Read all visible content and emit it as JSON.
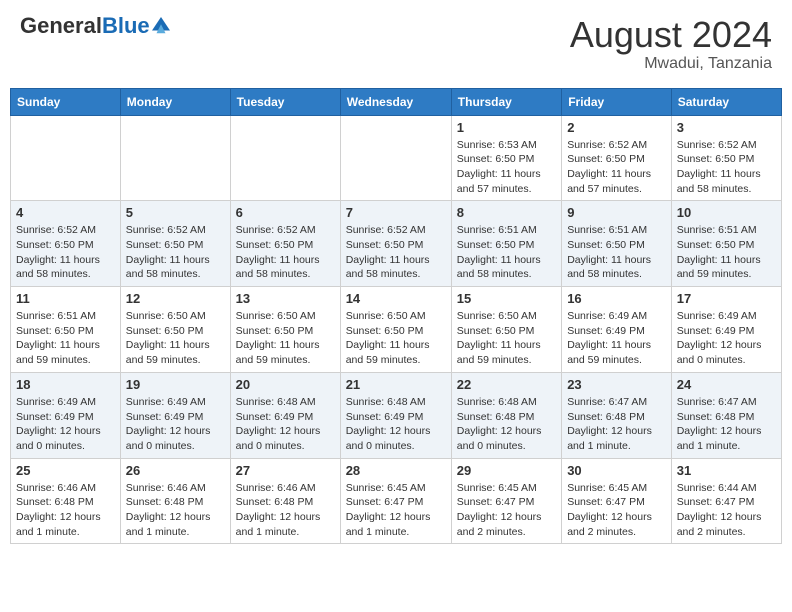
{
  "header": {
    "logo_general": "General",
    "logo_blue": "Blue",
    "month_year": "August 2024",
    "location": "Mwadui, Tanzania"
  },
  "days_of_week": [
    "Sunday",
    "Monday",
    "Tuesday",
    "Wednesday",
    "Thursday",
    "Friday",
    "Saturday"
  ],
  "weeks": [
    [
      {
        "day": "",
        "info": ""
      },
      {
        "day": "",
        "info": ""
      },
      {
        "day": "",
        "info": ""
      },
      {
        "day": "",
        "info": ""
      },
      {
        "day": "1",
        "info": "Sunrise: 6:53 AM\nSunset: 6:50 PM\nDaylight: 11 hours and 57 minutes."
      },
      {
        "day": "2",
        "info": "Sunrise: 6:52 AM\nSunset: 6:50 PM\nDaylight: 11 hours and 57 minutes."
      },
      {
        "day": "3",
        "info": "Sunrise: 6:52 AM\nSunset: 6:50 PM\nDaylight: 11 hours and 58 minutes."
      }
    ],
    [
      {
        "day": "4",
        "info": "Sunrise: 6:52 AM\nSunset: 6:50 PM\nDaylight: 11 hours and 58 minutes."
      },
      {
        "day": "5",
        "info": "Sunrise: 6:52 AM\nSunset: 6:50 PM\nDaylight: 11 hours and 58 minutes."
      },
      {
        "day": "6",
        "info": "Sunrise: 6:52 AM\nSunset: 6:50 PM\nDaylight: 11 hours and 58 minutes."
      },
      {
        "day": "7",
        "info": "Sunrise: 6:52 AM\nSunset: 6:50 PM\nDaylight: 11 hours and 58 minutes."
      },
      {
        "day": "8",
        "info": "Sunrise: 6:51 AM\nSunset: 6:50 PM\nDaylight: 11 hours and 58 minutes."
      },
      {
        "day": "9",
        "info": "Sunrise: 6:51 AM\nSunset: 6:50 PM\nDaylight: 11 hours and 58 minutes."
      },
      {
        "day": "10",
        "info": "Sunrise: 6:51 AM\nSunset: 6:50 PM\nDaylight: 11 hours and 59 minutes."
      }
    ],
    [
      {
        "day": "11",
        "info": "Sunrise: 6:51 AM\nSunset: 6:50 PM\nDaylight: 11 hours and 59 minutes."
      },
      {
        "day": "12",
        "info": "Sunrise: 6:50 AM\nSunset: 6:50 PM\nDaylight: 11 hours and 59 minutes."
      },
      {
        "day": "13",
        "info": "Sunrise: 6:50 AM\nSunset: 6:50 PM\nDaylight: 11 hours and 59 minutes."
      },
      {
        "day": "14",
        "info": "Sunrise: 6:50 AM\nSunset: 6:50 PM\nDaylight: 11 hours and 59 minutes."
      },
      {
        "day": "15",
        "info": "Sunrise: 6:50 AM\nSunset: 6:50 PM\nDaylight: 11 hours and 59 minutes."
      },
      {
        "day": "16",
        "info": "Sunrise: 6:49 AM\nSunset: 6:49 PM\nDaylight: 11 hours and 59 minutes."
      },
      {
        "day": "17",
        "info": "Sunrise: 6:49 AM\nSunset: 6:49 PM\nDaylight: 12 hours and 0 minutes."
      }
    ],
    [
      {
        "day": "18",
        "info": "Sunrise: 6:49 AM\nSunset: 6:49 PM\nDaylight: 12 hours and 0 minutes."
      },
      {
        "day": "19",
        "info": "Sunrise: 6:49 AM\nSunset: 6:49 PM\nDaylight: 12 hours and 0 minutes."
      },
      {
        "day": "20",
        "info": "Sunrise: 6:48 AM\nSunset: 6:49 PM\nDaylight: 12 hours and 0 minutes."
      },
      {
        "day": "21",
        "info": "Sunrise: 6:48 AM\nSunset: 6:49 PM\nDaylight: 12 hours and 0 minutes."
      },
      {
        "day": "22",
        "info": "Sunrise: 6:48 AM\nSunset: 6:48 PM\nDaylight: 12 hours and 0 minutes."
      },
      {
        "day": "23",
        "info": "Sunrise: 6:47 AM\nSunset: 6:48 PM\nDaylight: 12 hours and 1 minute."
      },
      {
        "day": "24",
        "info": "Sunrise: 6:47 AM\nSunset: 6:48 PM\nDaylight: 12 hours and 1 minute."
      }
    ],
    [
      {
        "day": "25",
        "info": "Sunrise: 6:46 AM\nSunset: 6:48 PM\nDaylight: 12 hours and 1 minute."
      },
      {
        "day": "26",
        "info": "Sunrise: 6:46 AM\nSunset: 6:48 PM\nDaylight: 12 hours and 1 minute."
      },
      {
        "day": "27",
        "info": "Sunrise: 6:46 AM\nSunset: 6:48 PM\nDaylight: 12 hours and 1 minute."
      },
      {
        "day": "28",
        "info": "Sunrise: 6:45 AM\nSunset: 6:47 PM\nDaylight: 12 hours and 1 minute."
      },
      {
        "day": "29",
        "info": "Sunrise: 6:45 AM\nSunset: 6:47 PM\nDaylight: 12 hours and 2 minutes."
      },
      {
        "day": "30",
        "info": "Sunrise: 6:45 AM\nSunset: 6:47 PM\nDaylight: 12 hours and 2 minutes."
      },
      {
        "day": "31",
        "info": "Sunrise: 6:44 AM\nSunset: 6:47 PM\nDaylight: 12 hours and 2 minutes."
      }
    ]
  ]
}
